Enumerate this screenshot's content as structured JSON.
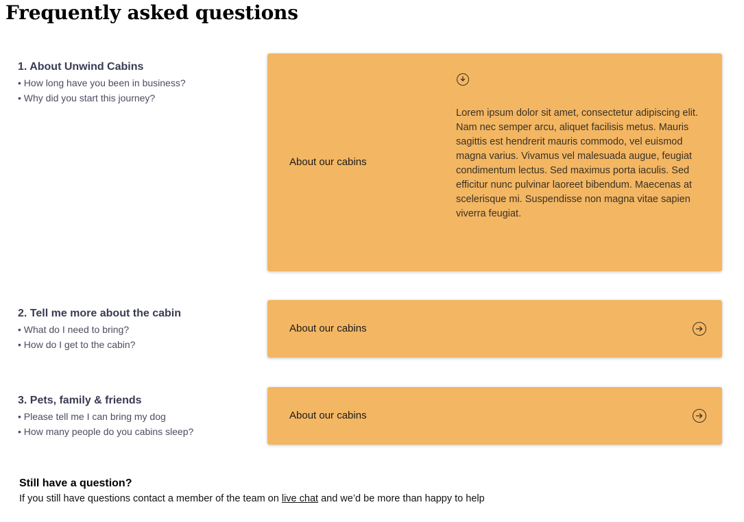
{
  "page": {
    "title": "Frequently asked questions"
  },
  "faq_sections": [
    {
      "title": "1. About Unwind Cabins",
      "questions": [
        "• How long have you been in business?",
        "• Why did you start this journey?"
      ],
      "card_label": "About our cabins",
      "expanded": true,
      "icon": "chevron-down-circle-icon",
      "body": "Lorem ipsum dolor sit amet, consectetur adipiscing elit. Nam nec semper arcu, aliquet facilisis metus. Mauris sagittis est hendrerit mauris commodo, vel euismod magna varius. Vivamus vel malesuada augue, feugiat condimentum lectus. Sed maximus porta iaculis. Sed efficitur nunc pulvinar laoreet bibendum. Maecenas at scelerisque mi. Suspendisse non magna vitae sapien viverra feugiat."
    },
    {
      "title": "2. Tell me more about the cabin",
      "questions": [
        "• What do I need to bring?",
        "• How do I get to the cabin?"
      ],
      "card_label": "About our cabins",
      "expanded": false,
      "icon": "arrow-right-circle-icon"
    },
    {
      "title": "3. Pets, family & friends",
      "questions": [
        "• Please tell me I can bring my dog",
        "• How many people do you cabins sleep?"
      ],
      "card_label": "About our cabins",
      "expanded": false,
      "icon": "arrow-right-circle-icon"
    }
  ],
  "contact": {
    "title": "Still have a question?",
    "text_before": "If you still have questions contact a member of the team on ",
    "link_text": "live chat",
    "text_after": " and we’d be more than happy to help"
  },
  "colors": {
    "card_background": "#f3b663",
    "section_text": "#3d3f55"
  }
}
